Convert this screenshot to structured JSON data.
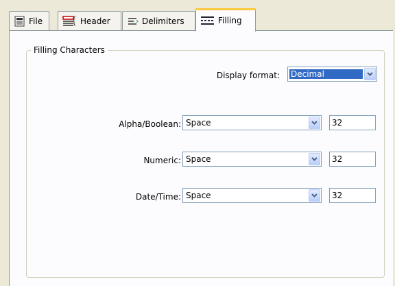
{
  "tabs": [
    {
      "label": "File",
      "icon": "file-icon",
      "active": false
    },
    {
      "label": "Header",
      "icon": "header-icon",
      "active": false
    },
    {
      "label": "Delimiters",
      "icon": "delimiters-icon",
      "active": false
    },
    {
      "label": "Filling",
      "icon": "filling-icon",
      "active": true
    }
  ],
  "group": {
    "title": "Filling Characters",
    "display_format": {
      "label": "Display format:",
      "value": "Decimal"
    },
    "rows": [
      {
        "label": "Alpha/Boolean:",
        "value": "Space",
        "code": "32"
      },
      {
        "label": "Numeric:",
        "value": "Space",
        "code": "32"
      },
      {
        "label": "Date/Time:",
        "value": "Space",
        "code": "32"
      }
    ]
  },
  "colors": {
    "selection": "#316ac5",
    "active_tab_accent": "#ffc73c",
    "border": "#7f9db9"
  }
}
